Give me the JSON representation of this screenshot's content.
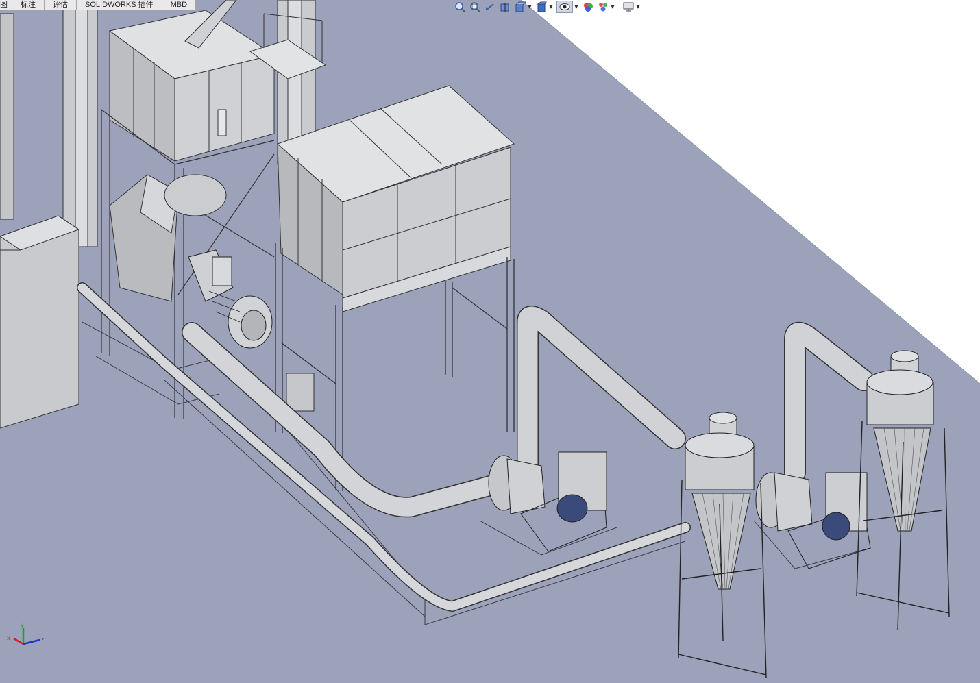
{
  "command_manager": {
    "tabs": [
      {
        "label": "图"
      },
      {
        "label": "标注"
      },
      {
        "label": "评估"
      },
      {
        "label": "SOLIDWORKS 插件"
      },
      {
        "label": "MBD"
      }
    ]
  },
  "heads_up_toolbar": {
    "icons": [
      "zoom-to-fit-icon",
      "zoom-to-area-icon",
      "previous-view-icon",
      "section-view-icon",
      "view-orientation-icon",
      "display-style-icon",
      "hide-show-items-icon",
      "edit-appearance-icon",
      "apply-scene-icon",
      "view-settings-icon"
    ]
  },
  "graphics_area": {
    "background_colors": {
      "top": "#ffffff",
      "floor": "#9ba2ba",
      "floor_dark": "#8f96ad"
    },
    "model_color": "#c7c9cc",
    "motor_color": "#3a4a7a"
  },
  "triad": {
    "axes": [
      {
        "label": "x",
        "color": "#d02020"
      },
      {
        "label": "y",
        "color": "#20a020"
      },
      {
        "label": "z",
        "color": "#2030c0"
      }
    ]
  }
}
